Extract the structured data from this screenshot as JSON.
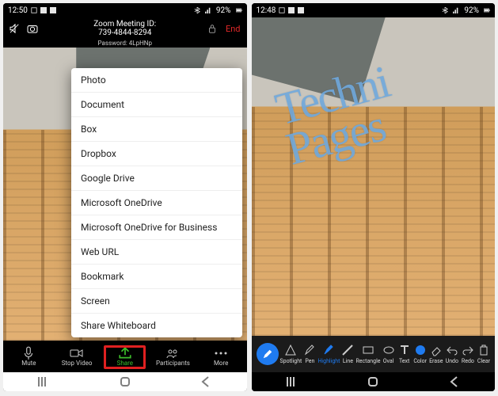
{
  "left": {
    "status": {
      "time": "12:50",
      "battery": "92%"
    },
    "header": {
      "title_line1": "Zoom Meeting ID:",
      "meeting_id": "739-4844-8294",
      "password_label": "Password: 4LpHNp",
      "end_label": "End"
    },
    "share_menu": {
      "items": [
        "Photo",
        "Document",
        "Box",
        "Dropbox",
        "Google Drive",
        "Microsoft OneDrive",
        "Microsoft OneDrive for Business",
        "Web URL",
        "Bookmark",
        "Screen",
        "Share Whiteboard"
      ]
    },
    "bottom_bar": {
      "mute": "Mute",
      "stop_video": "Stop Video",
      "share": "Share",
      "participants": "Participants",
      "more": "More"
    }
  },
  "right": {
    "status": {
      "time": "12:48",
      "battery": "92%"
    },
    "annotation_text_line1": "Techni",
    "annotation_text_line2": "Pages",
    "toolbar": {
      "spotlight": "Spotlight",
      "pen": "Pen",
      "highlight": "Highlight",
      "line": "Line",
      "rectangle": "Rectangle",
      "oval": "Oval",
      "text": "Text",
      "color": "Color",
      "erase": "Erase",
      "undo": "Undo",
      "redo": "Redo",
      "clear": "Clear"
    }
  }
}
